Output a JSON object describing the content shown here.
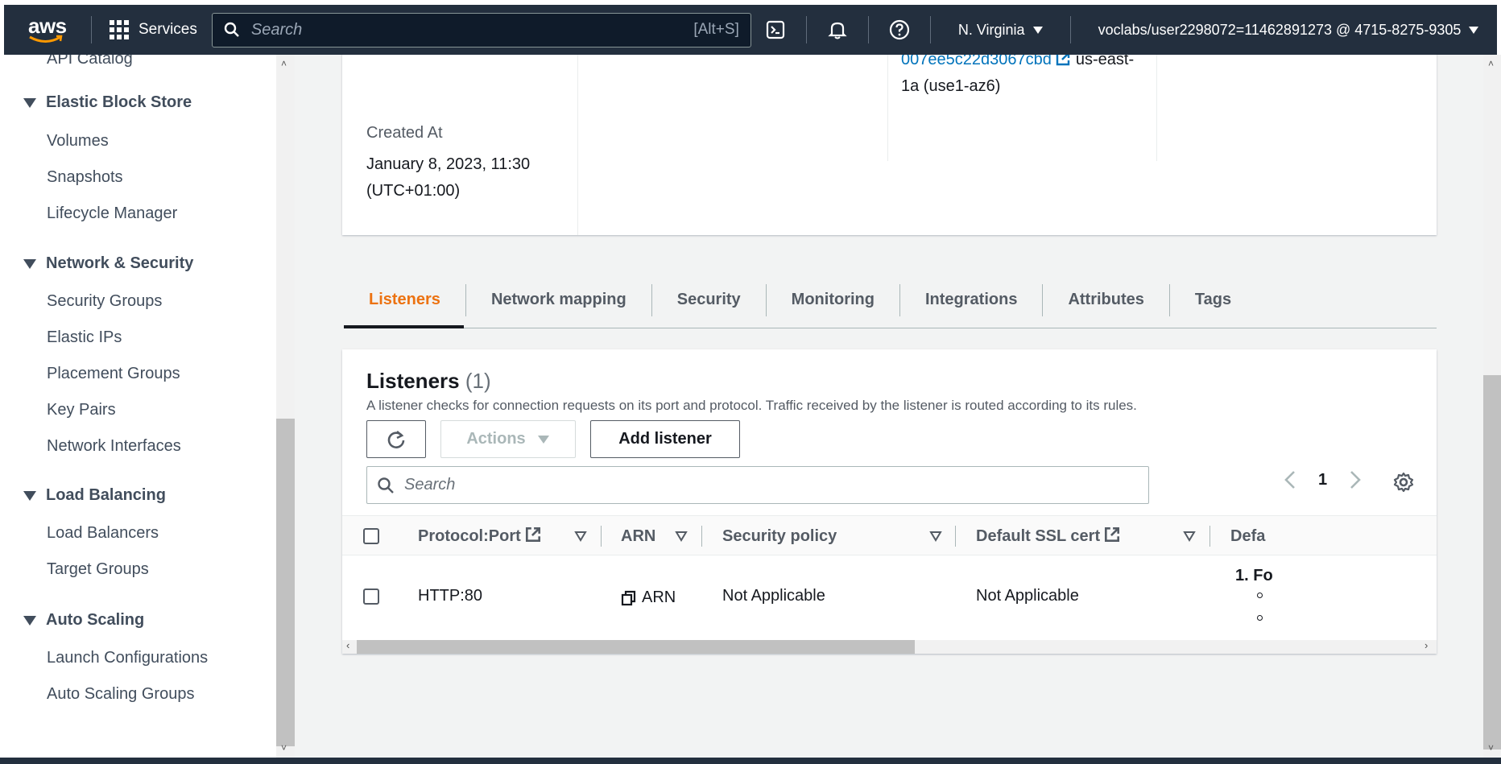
{
  "topnav": {
    "logo_text": "aws",
    "services_label": "Services",
    "search_placeholder": "Search",
    "search_shortcut": "[Alt+S]",
    "region": "N. Virginia",
    "account": "voclabs/user2298072=11462891273 @ 4715-8275-9305"
  },
  "sidebar": {
    "cut_item": "API Catalog",
    "sections": [
      {
        "title": "Elastic Block Store",
        "items": [
          "Volumes",
          "Snapshots",
          "Lifecycle Manager"
        ]
      },
      {
        "title": "Network & Security",
        "items": [
          "Security Groups",
          "Elastic IPs",
          "Placement Groups",
          "Key Pairs",
          "Network Interfaces"
        ]
      },
      {
        "title": "Load Balancing",
        "items": [
          "Load Balancers",
          "Target Groups"
        ]
      },
      {
        "title": "Auto Scaling",
        "items": [
          "Launch Configurations",
          "Auto Scaling Groups"
        ]
      }
    ]
  },
  "details": {
    "created_label": "Created At",
    "created_value": "January 8, 2023, 11:30 (UTC+01:00)",
    "subnet_link": "007ee5c22d3067cbd",
    "subnet_az": "us-east-1a (use1-az6)"
  },
  "tabs": [
    {
      "label": "Listeners",
      "active": true
    },
    {
      "label": "Network mapping",
      "active": false
    },
    {
      "label": "Security",
      "active": false
    },
    {
      "label": "Monitoring",
      "active": false
    },
    {
      "label": "Integrations",
      "active": false
    },
    {
      "label": "Attributes",
      "active": false
    },
    {
      "label": "Tags",
      "active": false
    }
  ],
  "listeners": {
    "title": "Listeners",
    "count": "(1)",
    "description": "A listener checks for connection requests on its port and protocol. Traffic received by the listener is routed according to its rules.",
    "actions_label": "Actions",
    "add_label": "Add listener",
    "search_placeholder": "Search",
    "page": "1",
    "columns": [
      "Protocol:Port",
      "ARN",
      "Security policy",
      "Default SSL cert",
      "Defa"
    ],
    "rows": [
      {
        "protocol_port": "HTTP:80",
        "arn": "ARN",
        "security_policy": "Not Applicable",
        "ssl_cert": "Not Applicable",
        "default_action_prefix": "1. Fo"
      }
    ]
  },
  "colors": {
    "nav_bg": "#232f3e",
    "active_tab": "#ec7211",
    "link": "#0073bb"
  }
}
